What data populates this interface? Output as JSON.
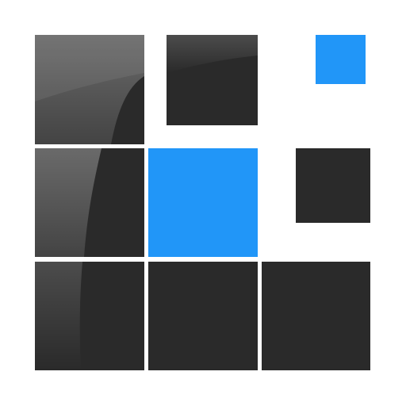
{
  "icon": {
    "name": "tile-grid-logo",
    "colors": {
      "background": "#ffffff",
      "dark_tile": "#2a2a2a",
      "blue_tile": "#2196f8"
    }
  }
}
